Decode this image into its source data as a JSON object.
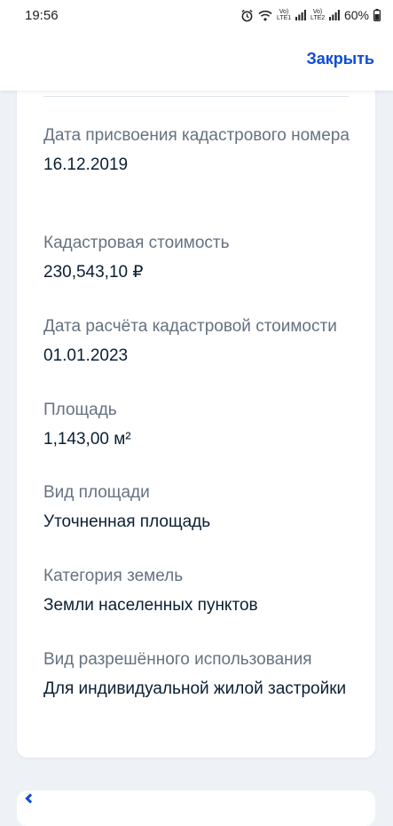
{
  "status_bar": {
    "time": "19:56",
    "lte1": "Vo) LTE1",
    "lte2": "Vo) LTE2",
    "battery": "60%"
  },
  "header": {
    "close_label": "Закрыть"
  },
  "fields": [
    {
      "label": "Дата присвоения кадастрового номера",
      "value": "16.12.2019"
    },
    {
      "label": "Кадастровая стоимость",
      "value": "230,543,10 ₽"
    },
    {
      "label": "Дата расчёта кадастровой стоимости",
      "value": "01.01.2023"
    },
    {
      "label": "Площадь",
      "value": "1,143,00 м²"
    },
    {
      "label": "Вид площади",
      "value": "Уточненная площадь"
    },
    {
      "label": "Категория земель",
      "value": "Земли населенных пунктов"
    },
    {
      "label": "Вид разрешённого использования",
      "value": "Для индивидуальной жилой застройки"
    }
  ],
  "colors": {
    "accent": "#0d4cd3",
    "label": "#66727f",
    "value": "#0b1f33",
    "background": "#eef2f7"
  }
}
